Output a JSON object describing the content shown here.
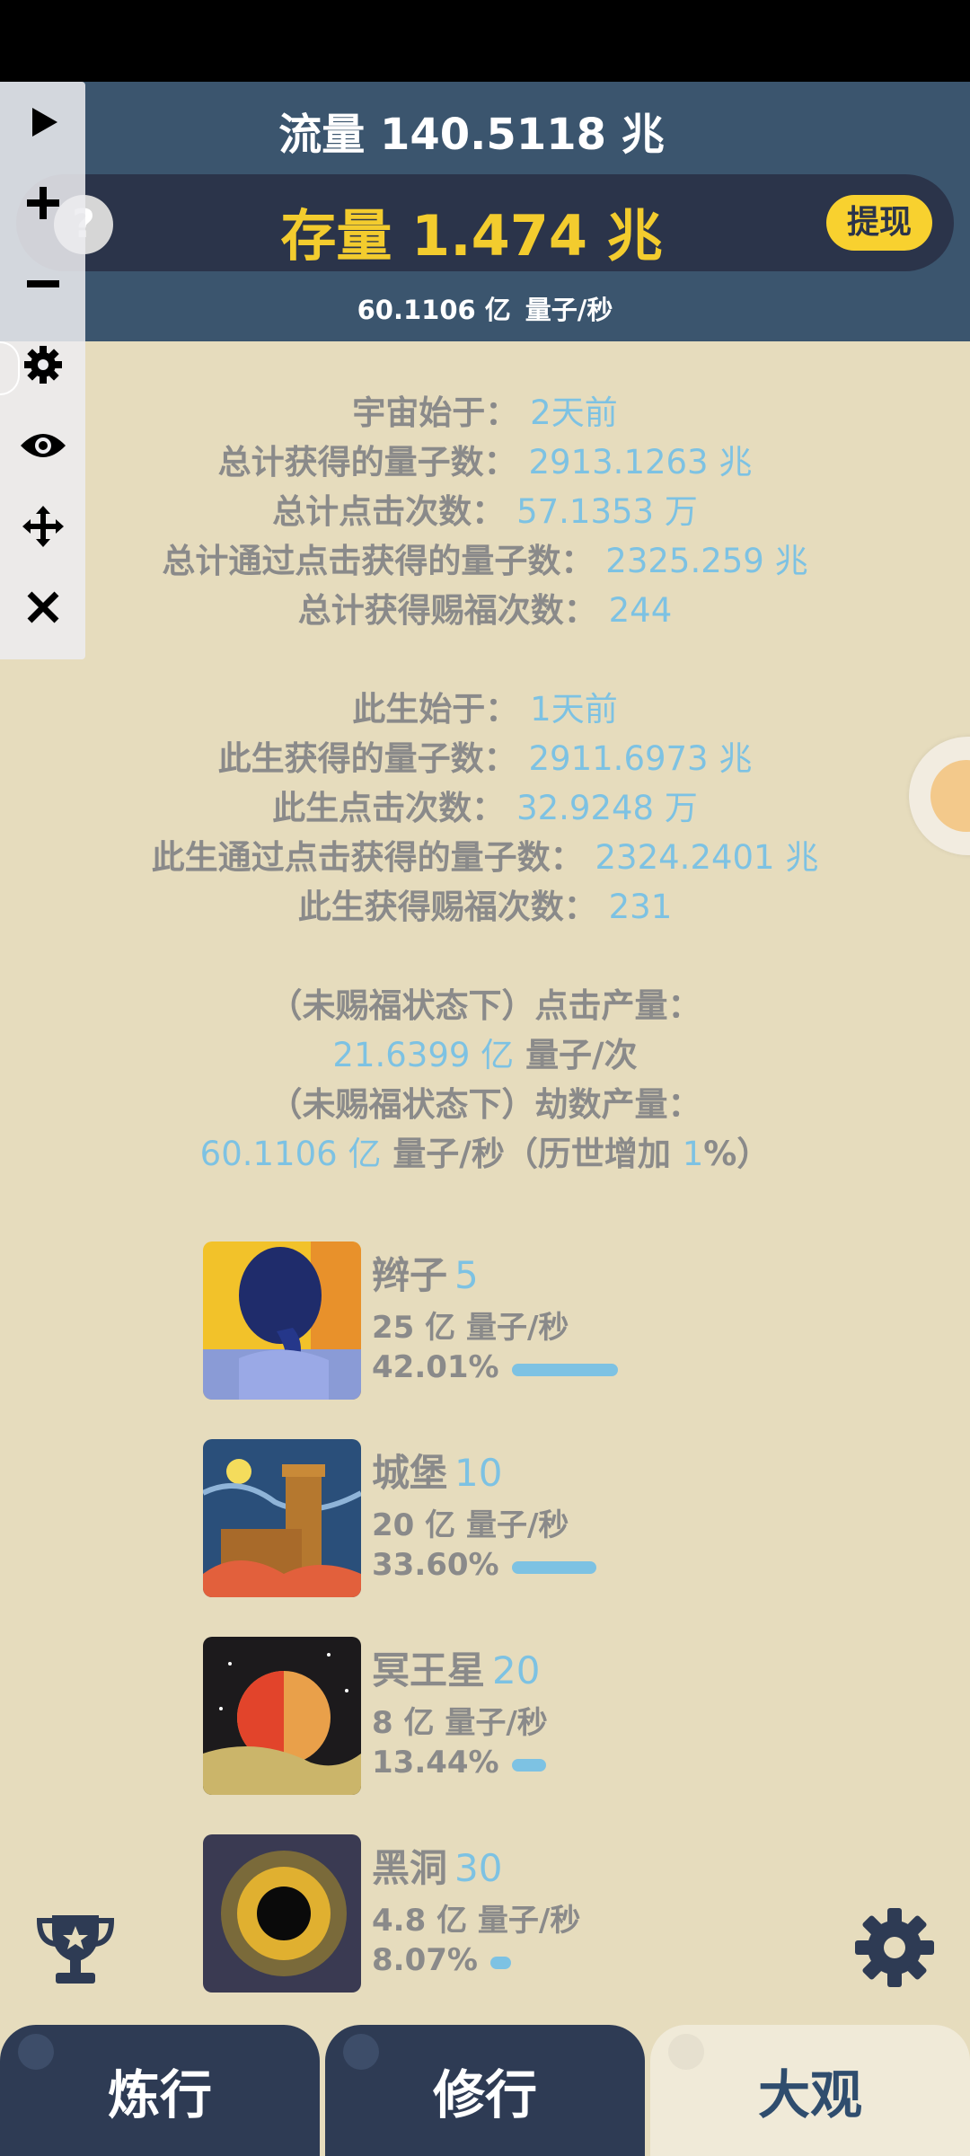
{
  "header": {
    "flow_label": "流量",
    "flow_value": "140.5118 兆",
    "stock_label": "存量",
    "stock_value": "1.474 兆",
    "withdraw_label": "提现",
    "rate_value": "60.1106 亿",
    "rate_unit": "量子/秒",
    "help_glyph": "?"
  },
  "toolbar": {
    "icons": [
      "play-icon",
      "plus-icon",
      "minus-icon",
      "settings-icon",
      "eye-icon",
      "move-icon",
      "close-icon"
    ]
  },
  "universe": [
    {
      "label": "宇宙始于：",
      "value": "2天前"
    },
    {
      "label": "总计获得的量子数：",
      "value": "2913.1263 兆"
    },
    {
      "label": "总计点击次数：",
      "value": "57.1353 万"
    },
    {
      "label": "总计通过点击获得的量子数：",
      "value": "2325.259 兆"
    },
    {
      "label": "总计获得赐福次数：",
      "value": "244"
    }
  ],
  "life": [
    {
      "label": "此生始于：",
      "value": "1天前"
    },
    {
      "label": "此生获得的量子数：",
      "value": "2911.6973 兆"
    },
    {
      "label": "此生点击次数：",
      "value": "32.9248 万"
    },
    {
      "label": "此生通过点击获得的量子数：",
      "value": "2324.2401 兆"
    },
    {
      "label": "此生获得赐福次数：",
      "value": "231"
    }
  ],
  "output": {
    "click_label": "（未赐福状态下）点击产量：",
    "click_value": "21.6399 亿",
    "click_unit": "量子/次",
    "kalpa_label": "（未赐福状态下）劫数产量：",
    "kalpa_value": "60.1106 亿",
    "kalpa_unit": "量子/秒（历世增加 ",
    "kalpa_bonus": "1",
    "kalpa_tail": "%）"
  },
  "items": [
    {
      "name": "辫子",
      "level": "5",
      "prod": "25 亿 量子/秒",
      "pct": "42.01%",
      "fraction": 0.4201,
      "art": "braid"
    },
    {
      "name": "城堡",
      "level": "10",
      "prod": "20 亿 量子/秒",
      "pct": "33.60%",
      "fraction": 0.336,
      "art": "castle"
    },
    {
      "name": "冥王星",
      "level": "20",
      "prod": "8 亿 量子/秒",
      "pct": "13.44%",
      "fraction": 0.1344,
      "art": "planet"
    },
    {
      "name": "黑洞",
      "level": "30",
      "prod": "4.8 亿 量子/秒",
      "pct": "8.07%",
      "fraction": 0.0807,
      "art": "blackhole"
    }
  ],
  "tabs": [
    {
      "label": "炼行",
      "active": false
    },
    {
      "label": "修行",
      "active": false
    },
    {
      "label": "大观",
      "active": true
    }
  ],
  "colors": {
    "background": "#e6dcbd",
    "header": "#3b556e",
    "accent_yellow": "#f3cc2e",
    "value_blue": "#7dc2e3",
    "tab_dark": "#2e3b54"
  }
}
